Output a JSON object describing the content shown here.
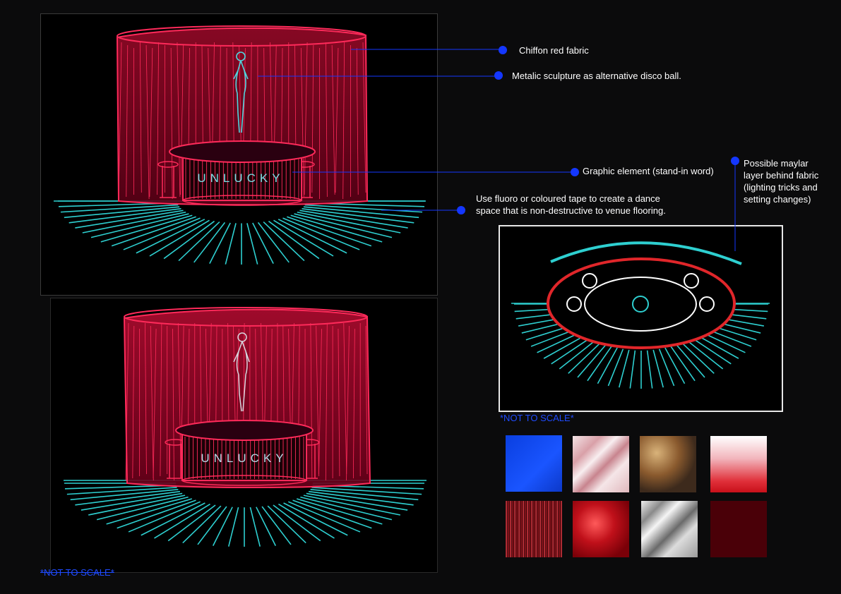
{
  "sign_word": "UNLUCKY",
  "annotations": {
    "chiffon": "Chiffon red fabric",
    "sculpture": "Metalic sculpture as alternative disco ball.",
    "graphic": "Graphic element (stand-in word)",
    "tape_line1": "Use fluoro or coloured tape to create a dance",
    "tape_line2": "space that is non-destructive to venue flooring.",
    "maylar_line1": "Possible maylar",
    "maylar_line2": "layer behind fabric",
    "maylar_line3": "(lighting tricks and",
    "maylar_line4": "setting changes)"
  },
  "not_to_scale_plan": "*NOT TO SCALE*",
  "not_to_scale_bottom": "*NOT TO SCALE*",
  "colors": {
    "fabric_red": "#ff1f4f",
    "tape_cyan": "#2ecfd0",
    "plan_red": "#e0262a",
    "accent_blue": "#1437ff",
    "label_blue": "#1f4bff"
  },
  "swatches": [
    {
      "name": "blue-fabric-swatch"
    },
    {
      "name": "pink-satin-swatch"
    },
    {
      "name": "baroque-painting-swatch"
    },
    {
      "name": "red-gradient-swatch"
    },
    {
      "name": "red-strands-swatch"
    },
    {
      "name": "red-silk-swatch"
    },
    {
      "name": "silver-foil-swatch"
    },
    {
      "name": "dark-red-swatch"
    }
  ]
}
